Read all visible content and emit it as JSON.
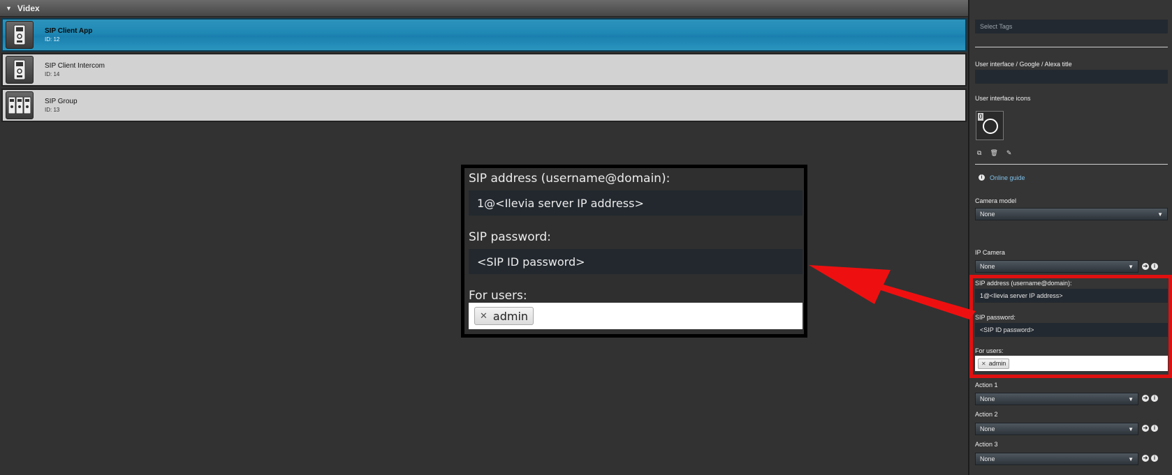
{
  "group": {
    "title": "Videx"
  },
  "devices": [
    {
      "name": "SIP Client App",
      "id": "ID: 12"
    },
    {
      "name": "SIP Client Intercom",
      "id": "ID: 14"
    },
    {
      "name": "SIP Group",
      "id": "ID: 13"
    }
  ],
  "zoom": {
    "sip_address_label": "SIP address (username@domain):",
    "sip_address_value": "1@<Ilevia server IP address>",
    "sip_password_label": "SIP password:",
    "sip_password_value": "<SIP ID password>",
    "users_label": "For users:",
    "user_tag": "admin"
  },
  "panel": {
    "tags_placeholder": "Select Tags",
    "title_label": "User interface / Google / Alexa title",
    "title_value": "",
    "icons_label": "User interface icons",
    "icon_index": "0",
    "online_guide": "Online guide",
    "camera_model_label": "Camera model",
    "camera_model_value": "None",
    "ip_camera_label": "IP Camera",
    "ip_camera_value": "None",
    "sip_address_label": "SIP address (username@domain):",
    "sip_address_value": "1@<Ilevia server IP address>",
    "sip_password_label": "SIP password:",
    "sip_password_value": "<SIP ID password>",
    "users_label": "For users:",
    "user_tag": "admin",
    "actions": [
      {
        "label": "Action 1",
        "value": "None"
      },
      {
        "label": "Action 2",
        "value": "None"
      },
      {
        "label": "Action 3",
        "value": "None"
      }
    ]
  },
  "colors": {
    "accent": "#1f88b4",
    "highlight": "#e01010",
    "link": "#7fc0e8"
  },
  "icons": [
    "intercom-device-icon",
    "intercom-device-icon",
    "intercom-group-icon",
    "copy-icon",
    "trash-icon",
    "edit-icon",
    "info-icon",
    "arrow-right-icon"
  ]
}
